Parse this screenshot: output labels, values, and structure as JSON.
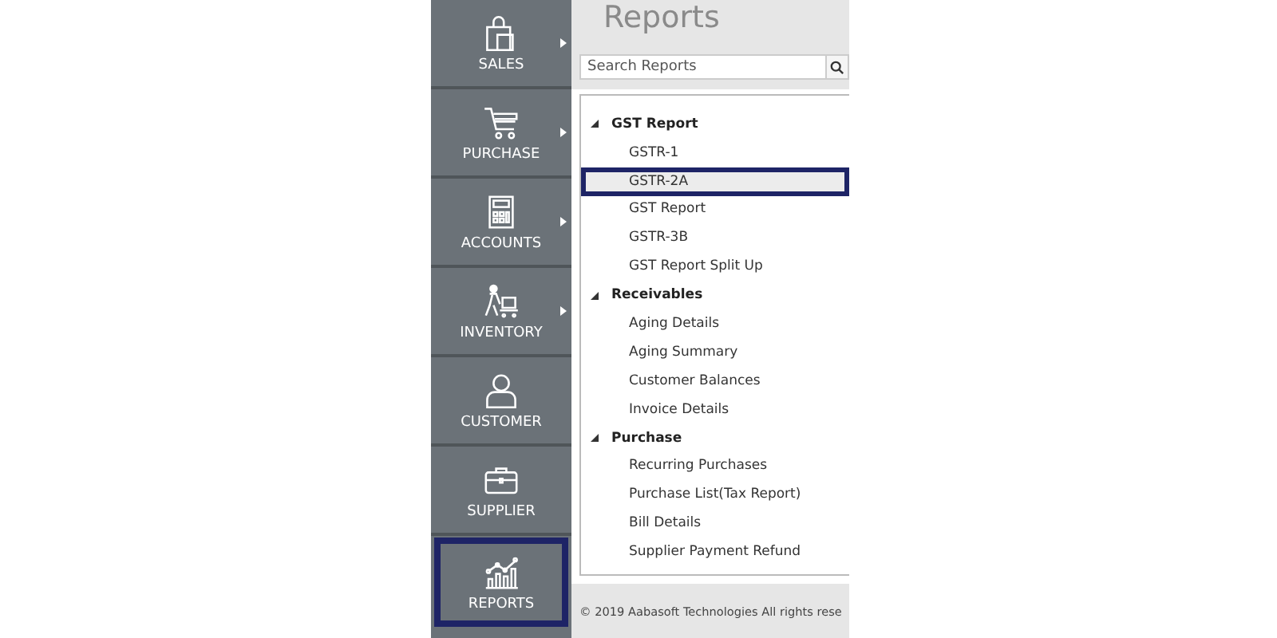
{
  "sidebar": {
    "items": [
      {
        "label": "SALES",
        "kind": "bag",
        "has_submenu": true,
        "selected": false
      },
      {
        "label": "PURCHASE",
        "kind": "cart",
        "has_submenu": true,
        "selected": false
      },
      {
        "label": "ACCOUNTS",
        "kind": "calculator",
        "has_submenu": true,
        "selected": false
      },
      {
        "label": "INVENTORY",
        "kind": "trolley",
        "has_submenu": true,
        "selected": false
      },
      {
        "label": "CUSTOMER",
        "kind": "person",
        "has_submenu": false,
        "selected": false
      },
      {
        "label": "SUPPLIER",
        "kind": "briefcase",
        "has_submenu": false,
        "selected": false
      },
      {
        "label": "REPORTS",
        "kind": "chart",
        "has_submenu": false,
        "selected": true
      }
    ]
  },
  "header": {
    "title": "Reports"
  },
  "search": {
    "placeholder": "Search Reports"
  },
  "tree": [
    {
      "label": "GST Report",
      "expanded": true,
      "children": [
        {
          "label": "GSTR-1",
          "selected": false
        },
        {
          "label": "GSTR-2A",
          "selected": true
        },
        {
          "label": "GST Report",
          "selected": false
        },
        {
          "label": "GSTR-3B",
          "selected": false
        },
        {
          "label": "GST Report Split Up",
          "selected": false
        }
      ]
    },
    {
      "label": "Receivables",
      "expanded": true,
      "children": [
        {
          "label": "Aging Details",
          "selected": false
        },
        {
          "label": "Aging Summary",
          "selected": false
        },
        {
          "label": "Customer Balances",
          "selected": false
        },
        {
          "label": "Invoice Details",
          "selected": false
        }
      ]
    },
    {
      "label": "Purchase",
      "expanded": true,
      "children": [
        {
          "label": "Recurring Purchases",
          "selected": false
        },
        {
          "label": "Purchase List(Tax Report)",
          "selected": false
        },
        {
          "label": "Bill Details",
          "selected": false
        },
        {
          "label": "Supplier Payment Refund",
          "selected": false
        }
      ]
    }
  ],
  "footer": {
    "text": "© 2019 Aabasoft Technologies All rights rese"
  }
}
